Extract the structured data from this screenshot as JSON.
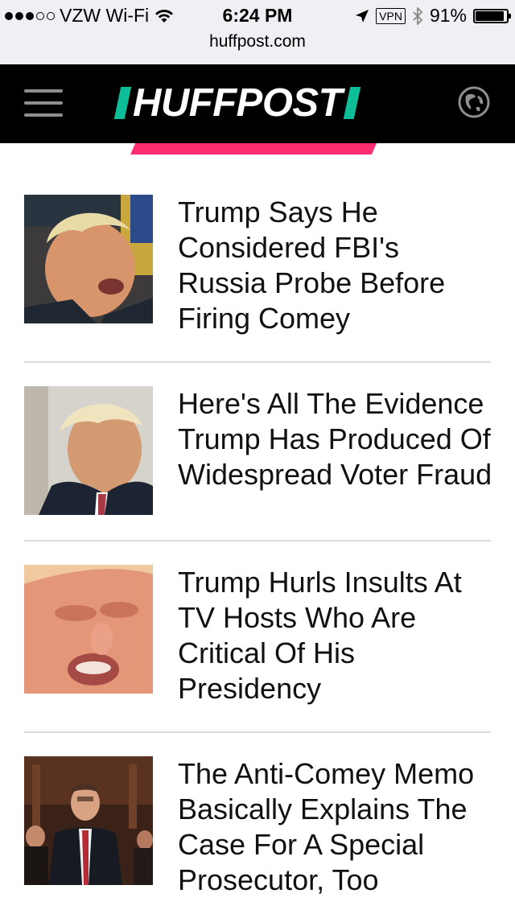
{
  "status_bar": {
    "carrier": "VZW Wi-Fi",
    "time": "6:24 PM",
    "vpn": "VPN",
    "battery": "91%",
    "battery_level": 0.91
  },
  "browser": {
    "url": "huffpost.com"
  },
  "nav": {
    "logo": "HUFFPOST"
  },
  "articles": [
    {
      "headline": "Trump Says He Considered FBI's Russia Probe Before Firing Comey"
    },
    {
      "headline": "Here's All The Evidence Trump Has Produced Of Widespread Voter Fraud"
    },
    {
      "headline": "Trump Hurls Insults At TV Hosts Who Are Critical Of His Presidency"
    },
    {
      "headline": "The Anti-Comey Memo Basically Explains The Case For A Special Prosecutor, Too"
    }
  ]
}
